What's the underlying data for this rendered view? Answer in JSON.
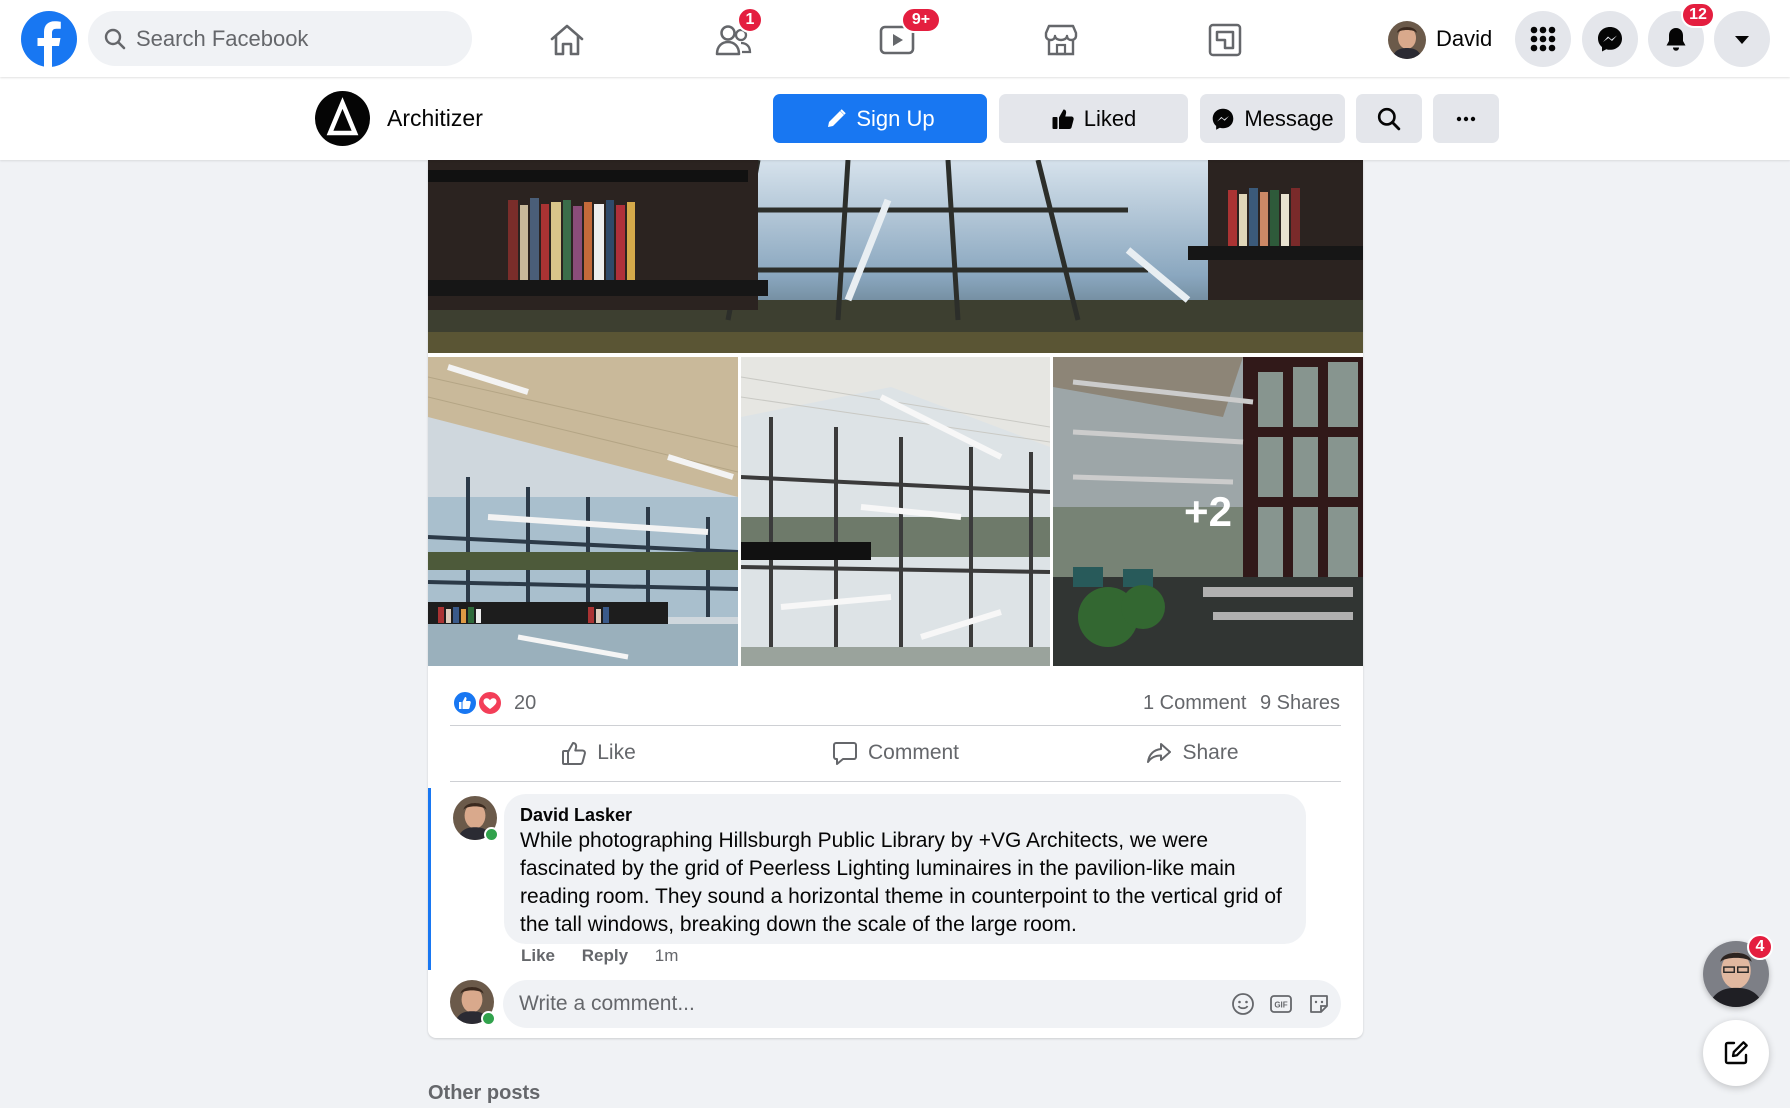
{
  "topbar": {
    "search_placeholder": "Search Facebook",
    "friends_badge": "1",
    "watch_badge": "9+",
    "profile_name": "David",
    "notifications_badge": "12"
  },
  "page_header": {
    "name": "Architizer",
    "signup_label": "Sign Up",
    "liked_label": "Liked",
    "message_label": "Message"
  },
  "post": {
    "more_photos_label": "+2",
    "reaction_count": "20",
    "comments_count": "1 Comment",
    "shares_count": "9 Shares",
    "actions": {
      "like": "Like",
      "comment": "Comment",
      "share": "Share"
    },
    "comment": {
      "author": "David Lasker",
      "text": "While photographing Hillsburgh Public Library by +VG Architects, we were fascinated by the grid of Peerless Lighting luminaires in the pavilion-like main reading room. They sound a horizontal theme in counterpoint to the vertical grid of the tall windows, breaking down the scale of the large room.",
      "like_label": "Like",
      "reply_label": "Reply",
      "time": "1m"
    },
    "write_placeholder": "Write a comment..."
  },
  "other_posts_label": "Other posts",
  "floating": {
    "chat_badge": "4"
  },
  "colors": {
    "brand_blue": "#1877f2",
    "badge_red": "#e41e3f",
    "background": "#f0f2f5"
  }
}
